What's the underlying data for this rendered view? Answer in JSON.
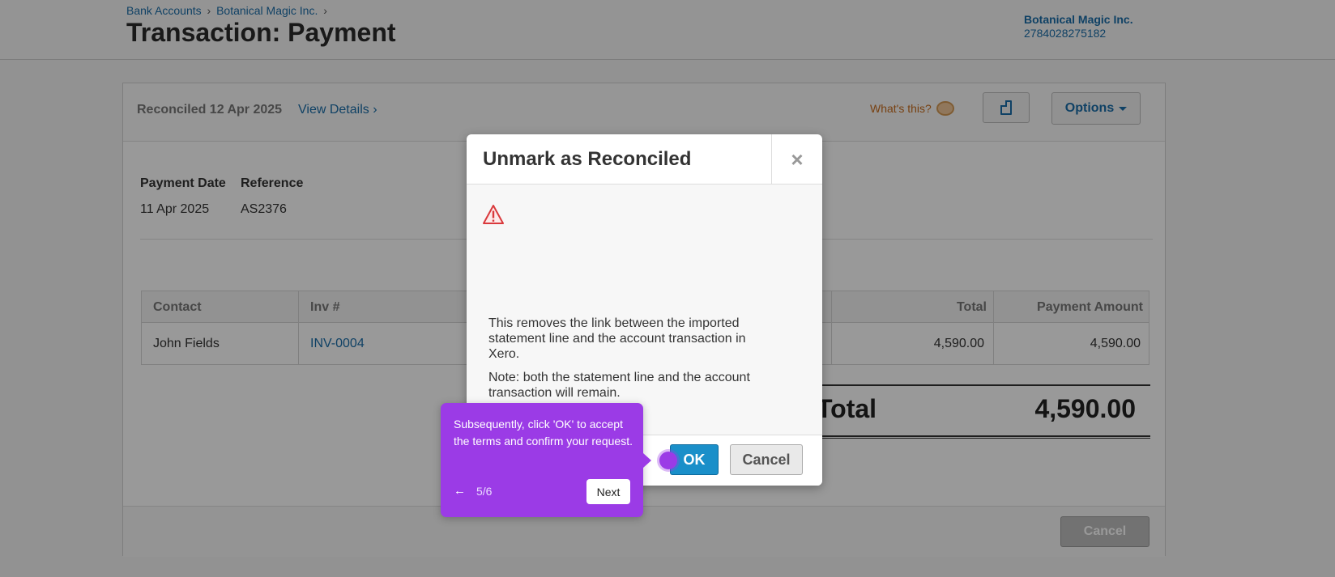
{
  "header": {
    "breadcrumb": [
      "Bank Accounts",
      "Botanical Magic Inc."
    ],
    "breadcrumb_separator": "›",
    "title": "Transaction: Payment",
    "org_name": "Botanical Magic Inc.",
    "org_code": "2784028275182"
  },
  "panel": {
    "reconciled_text": "Reconciled 12 Apr 2025",
    "view_details": "View Details ›",
    "whats_this": "What's this?",
    "options_label": "Options",
    "fields": [
      {
        "label": "Payment Date",
        "value": "11 Apr 2025"
      },
      {
        "label": "Reference",
        "value": "AS2376"
      }
    ],
    "table": {
      "headers": [
        "Contact",
        "Inv #",
        "Total",
        "Payment Amount"
      ],
      "rows": [
        {
          "contact": "John Fields",
          "inv": "INV-0004",
          "total": "4,590.00",
          "payment": "4,590.00"
        }
      ]
    },
    "total_label": "Total",
    "total_value": "4,590.00",
    "footer_cancel": "Cancel"
  },
  "modal": {
    "title": "Unmark as Reconciled",
    "close_symbol": "×",
    "text1": "This removes the link between the imported statement line and the account transaction in Xero.",
    "text2": "Note: both the statement line and the account transaction will remain.",
    "ok_label": "OK",
    "cancel_label": "Cancel"
  },
  "tooltip": {
    "text": "Subsequently, click 'OK' to accept the terms and confirm your request.",
    "back_symbol": "←",
    "step": "5/6",
    "next_label": "Next",
    "color": "#9b3be6"
  },
  "colors": {
    "link": "#1a6da8",
    "accent_button": "#1a8fc9"
  }
}
